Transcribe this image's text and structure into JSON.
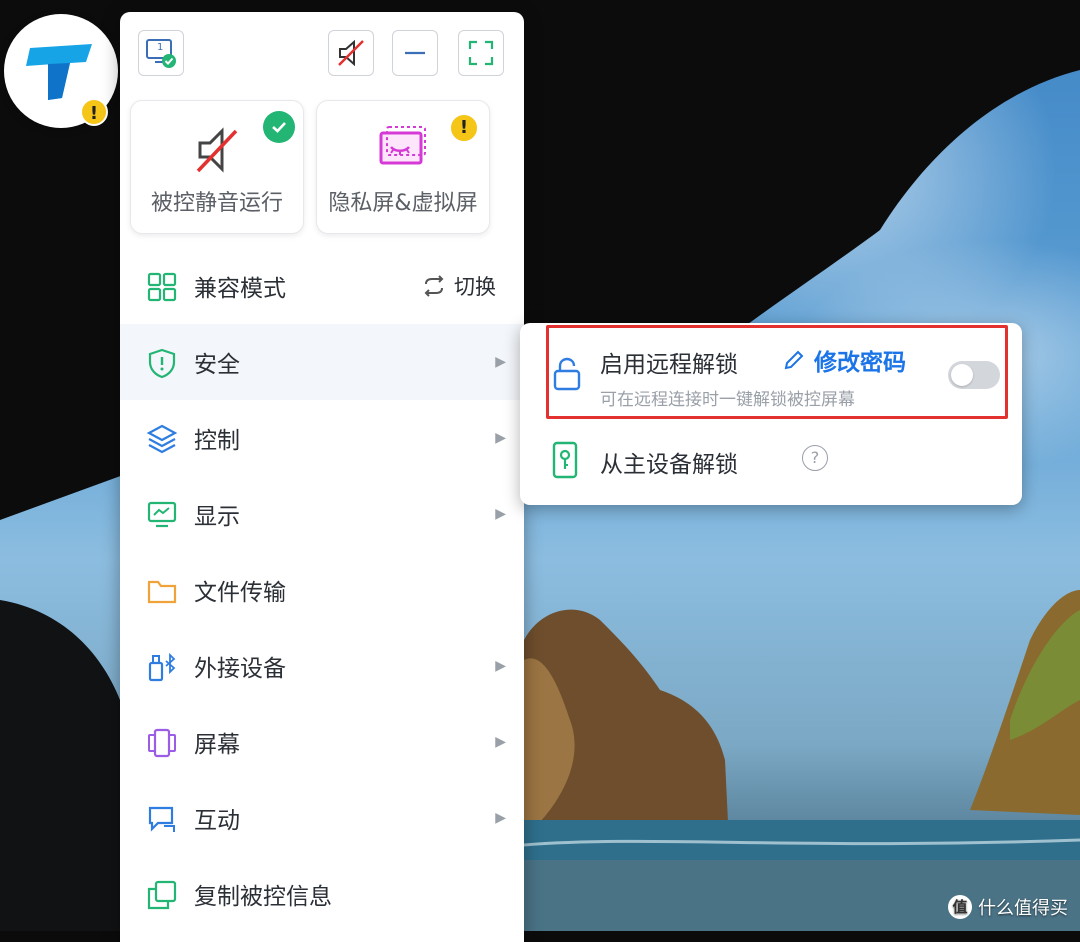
{
  "top_controls": {
    "monitor_number": "1"
  },
  "cards": [
    {
      "label": "被控静音运行",
      "status": "enabled"
    },
    {
      "label": "隐私屏&虚拟屏",
      "status": "warning",
      "badge": "!"
    }
  ],
  "app_badge": "!",
  "menu": {
    "items": [
      {
        "label": "兼容模式",
        "action": "切换"
      },
      {
        "label": "安全"
      },
      {
        "label": "控制"
      },
      {
        "label": "显示"
      },
      {
        "label": "文件传输"
      },
      {
        "label": "外接设备"
      },
      {
        "label": "屏幕"
      },
      {
        "label": "互动"
      },
      {
        "label": "复制被控信息"
      }
    ]
  },
  "submenu": {
    "remote_unlock": {
      "title": "启用远程解锁",
      "edit_label": "修改密码",
      "description": "可在远程连接时一键解锁被控屏幕",
      "enabled": false
    },
    "master_unlock": {
      "title": "从主设备解锁",
      "help": "?"
    }
  },
  "watermark": {
    "logo": "值",
    "text": "什么值得买"
  },
  "colors": {
    "accent_blue": "#1b74e8",
    "success_green": "#22b573",
    "warning_yellow": "#f5c518",
    "highlight_red": "#e2312f"
  }
}
